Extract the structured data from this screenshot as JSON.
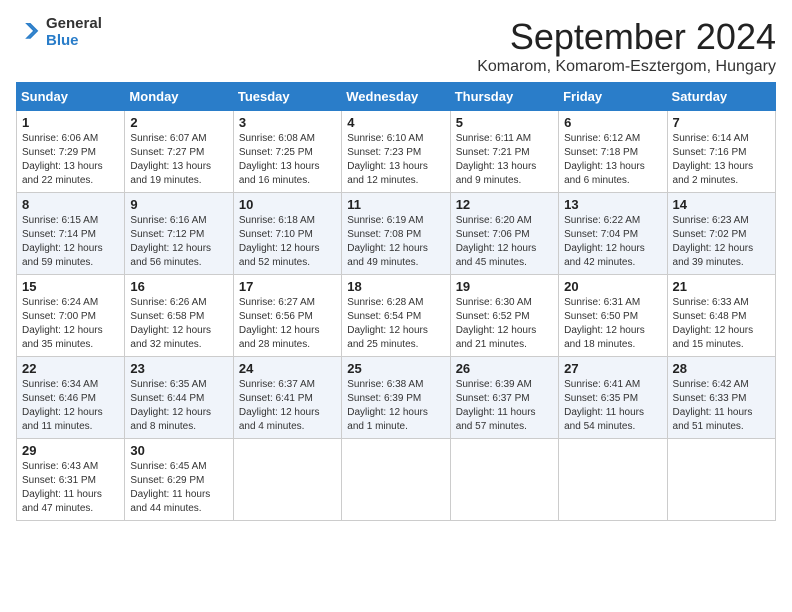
{
  "logo": {
    "general": "General",
    "blue": "Blue"
  },
  "title": "September 2024",
  "location": "Komarom, Komarom-Esztergom, Hungary",
  "headers": [
    "Sunday",
    "Monday",
    "Tuesday",
    "Wednesday",
    "Thursday",
    "Friday",
    "Saturday"
  ],
  "weeks": [
    [
      {
        "day": "1",
        "sunrise": "Sunrise: 6:06 AM",
        "sunset": "Sunset: 7:29 PM",
        "daylight": "Daylight: 13 hours and 22 minutes."
      },
      {
        "day": "2",
        "sunrise": "Sunrise: 6:07 AM",
        "sunset": "Sunset: 7:27 PM",
        "daylight": "Daylight: 13 hours and 19 minutes."
      },
      {
        "day": "3",
        "sunrise": "Sunrise: 6:08 AM",
        "sunset": "Sunset: 7:25 PM",
        "daylight": "Daylight: 13 hours and 16 minutes."
      },
      {
        "day": "4",
        "sunrise": "Sunrise: 6:10 AM",
        "sunset": "Sunset: 7:23 PM",
        "daylight": "Daylight: 13 hours and 12 minutes."
      },
      {
        "day": "5",
        "sunrise": "Sunrise: 6:11 AM",
        "sunset": "Sunset: 7:21 PM",
        "daylight": "Daylight: 13 hours and 9 minutes."
      },
      {
        "day": "6",
        "sunrise": "Sunrise: 6:12 AM",
        "sunset": "Sunset: 7:18 PM",
        "daylight": "Daylight: 13 hours and 6 minutes."
      },
      {
        "day": "7",
        "sunrise": "Sunrise: 6:14 AM",
        "sunset": "Sunset: 7:16 PM",
        "daylight": "Daylight: 13 hours and 2 minutes."
      }
    ],
    [
      {
        "day": "8",
        "sunrise": "Sunrise: 6:15 AM",
        "sunset": "Sunset: 7:14 PM",
        "daylight": "Daylight: 12 hours and 59 minutes."
      },
      {
        "day": "9",
        "sunrise": "Sunrise: 6:16 AM",
        "sunset": "Sunset: 7:12 PM",
        "daylight": "Daylight: 12 hours and 56 minutes."
      },
      {
        "day": "10",
        "sunrise": "Sunrise: 6:18 AM",
        "sunset": "Sunset: 7:10 PM",
        "daylight": "Daylight: 12 hours and 52 minutes."
      },
      {
        "day": "11",
        "sunrise": "Sunrise: 6:19 AM",
        "sunset": "Sunset: 7:08 PM",
        "daylight": "Daylight: 12 hours and 49 minutes."
      },
      {
        "day": "12",
        "sunrise": "Sunrise: 6:20 AM",
        "sunset": "Sunset: 7:06 PM",
        "daylight": "Daylight: 12 hours and 45 minutes."
      },
      {
        "day": "13",
        "sunrise": "Sunrise: 6:22 AM",
        "sunset": "Sunset: 7:04 PM",
        "daylight": "Daylight: 12 hours and 42 minutes."
      },
      {
        "day": "14",
        "sunrise": "Sunrise: 6:23 AM",
        "sunset": "Sunset: 7:02 PM",
        "daylight": "Daylight: 12 hours and 39 minutes."
      }
    ],
    [
      {
        "day": "15",
        "sunrise": "Sunrise: 6:24 AM",
        "sunset": "Sunset: 7:00 PM",
        "daylight": "Daylight: 12 hours and 35 minutes."
      },
      {
        "day": "16",
        "sunrise": "Sunrise: 6:26 AM",
        "sunset": "Sunset: 6:58 PM",
        "daylight": "Daylight: 12 hours and 32 minutes."
      },
      {
        "day": "17",
        "sunrise": "Sunrise: 6:27 AM",
        "sunset": "Sunset: 6:56 PM",
        "daylight": "Daylight: 12 hours and 28 minutes."
      },
      {
        "day": "18",
        "sunrise": "Sunrise: 6:28 AM",
        "sunset": "Sunset: 6:54 PM",
        "daylight": "Daylight: 12 hours and 25 minutes."
      },
      {
        "day": "19",
        "sunrise": "Sunrise: 6:30 AM",
        "sunset": "Sunset: 6:52 PM",
        "daylight": "Daylight: 12 hours and 21 minutes."
      },
      {
        "day": "20",
        "sunrise": "Sunrise: 6:31 AM",
        "sunset": "Sunset: 6:50 PM",
        "daylight": "Daylight: 12 hours and 18 minutes."
      },
      {
        "day": "21",
        "sunrise": "Sunrise: 6:33 AM",
        "sunset": "Sunset: 6:48 PM",
        "daylight": "Daylight: 12 hours and 15 minutes."
      }
    ],
    [
      {
        "day": "22",
        "sunrise": "Sunrise: 6:34 AM",
        "sunset": "Sunset: 6:46 PM",
        "daylight": "Daylight: 12 hours and 11 minutes."
      },
      {
        "day": "23",
        "sunrise": "Sunrise: 6:35 AM",
        "sunset": "Sunset: 6:44 PM",
        "daylight": "Daylight: 12 hours and 8 minutes."
      },
      {
        "day": "24",
        "sunrise": "Sunrise: 6:37 AM",
        "sunset": "Sunset: 6:41 PM",
        "daylight": "Daylight: 12 hours and 4 minutes."
      },
      {
        "day": "25",
        "sunrise": "Sunrise: 6:38 AM",
        "sunset": "Sunset: 6:39 PM",
        "daylight": "Daylight: 12 hours and 1 minute."
      },
      {
        "day": "26",
        "sunrise": "Sunrise: 6:39 AM",
        "sunset": "Sunset: 6:37 PM",
        "daylight": "Daylight: 11 hours and 57 minutes."
      },
      {
        "day": "27",
        "sunrise": "Sunrise: 6:41 AM",
        "sunset": "Sunset: 6:35 PM",
        "daylight": "Daylight: 11 hours and 54 minutes."
      },
      {
        "day": "28",
        "sunrise": "Sunrise: 6:42 AM",
        "sunset": "Sunset: 6:33 PM",
        "daylight": "Daylight: 11 hours and 51 minutes."
      }
    ],
    [
      {
        "day": "29",
        "sunrise": "Sunrise: 6:43 AM",
        "sunset": "Sunset: 6:31 PM",
        "daylight": "Daylight: 11 hours and 47 minutes."
      },
      {
        "day": "30",
        "sunrise": "Sunrise: 6:45 AM",
        "sunset": "Sunset: 6:29 PM",
        "daylight": "Daylight: 11 hours and 44 minutes."
      },
      null,
      null,
      null,
      null,
      null
    ]
  ]
}
